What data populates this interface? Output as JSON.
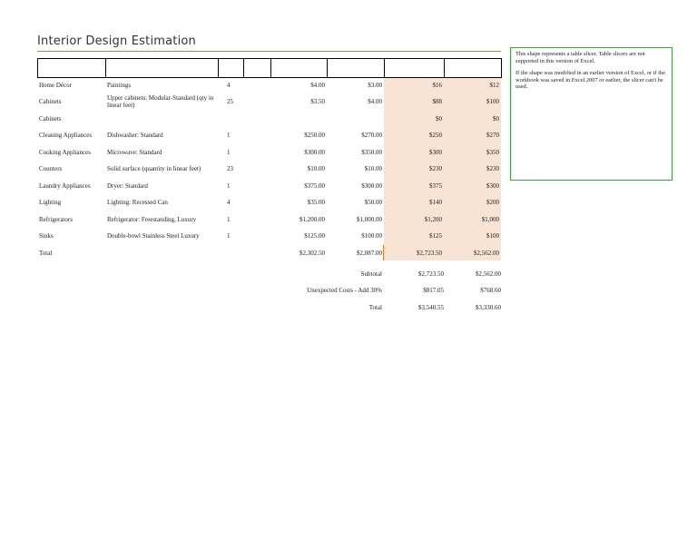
{
  "title": "Interior Design Estimation",
  "rows": [
    {
      "category": "Home Décor",
      "item": "Paintings",
      "qty": "4",
      "cost_low": "$4.00",
      "cost_high": "$3.00",
      "total_low": "$16",
      "total_high": "$12"
    },
    {
      "category": "Cabinets",
      "item": "Upper cabinets: Modular-Standard (qty in linear feet)",
      "qty": "25",
      "cost_low": "$3.50",
      "cost_high": "$4.00",
      "total_low": "$88",
      "total_high": "$100"
    },
    {
      "category": "Cabinets",
      "item": "",
      "qty": "",
      "cost_low": "",
      "cost_high": "",
      "total_low": "$0",
      "total_high": "$0"
    },
    {
      "category": "Cleaning Appliances",
      "item": "Dishwasher: Standard",
      "qty": "1",
      "cost_low": "$250.00",
      "cost_high": "$270.00",
      "total_low": "$250",
      "total_high": "$270"
    },
    {
      "category": "Cooking Appliances",
      "item": "Microwave: Standard",
      "qty": "1",
      "cost_low": "$300.00",
      "cost_high": "$350.00",
      "total_low": "$300",
      "total_high": "$350"
    },
    {
      "category": "Counters",
      "item": "Solid surface (quantity in linear feet)",
      "qty": "23",
      "cost_low": "$10.00",
      "cost_high": "$10.00",
      "total_low": "$230",
      "total_high": "$230"
    },
    {
      "category": "Laundry Appliances",
      "item": "Dryer: Standard",
      "qty": "1",
      "cost_low": "$375.00",
      "cost_high": "$300.00",
      "total_low": "$375",
      "total_high": "$300"
    },
    {
      "category": "Lighting",
      "item": "Lighting: Recessed Can",
      "qty": "4",
      "cost_low": "$35.00",
      "cost_high": "$50.00",
      "total_low": "$140",
      "total_high": "$200"
    },
    {
      "category": "Refrigerators",
      "item": "Refrigerator: Freestanding, Luxury",
      "qty": "1",
      "cost_low": "$1,200.00",
      "cost_high": "$1,000.00",
      "total_low": "$1,200",
      "total_high": "$1,000"
    },
    {
      "category": "Sinks",
      "item": "Double-bowl Stainless Steel Luxury",
      "qty": "1",
      "cost_low": "$125.00",
      "cost_high": "$100.00",
      "total_low": "$125",
      "total_high": "$100"
    },
    {
      "category": "Total",
      "item": "",
      "qty": "",
      "cost_low": "$2,302.50",
      "cost_high": "$2,087.00",
      "total_low": "$2,723.50",
      "total_high": "$2,562.00"
    }
  ],
  "summary": [
    {
      "label": "Subtotal",
      "low": "$2,723.50",
      "high": "$2,562.00"
    },
    {
      "label": "Unexpected Costs - Add 30%",
      "low": "$817.05",
      "high": "$768.60"
    },
    {
      "label": "Total",
      "low": "$3,540.55",
      "high": "$3,330.60"
    }
  ],
  "slicer": {
    "p1": "This shape represents a table slicer. Table slicers are not supported in this version of Excel.",
    "p2": "If the shape was modified in an earlier version of Excel, or if the workbook was saved in Excel 2007 or earlier, the slicer can't be used."
  }
}
